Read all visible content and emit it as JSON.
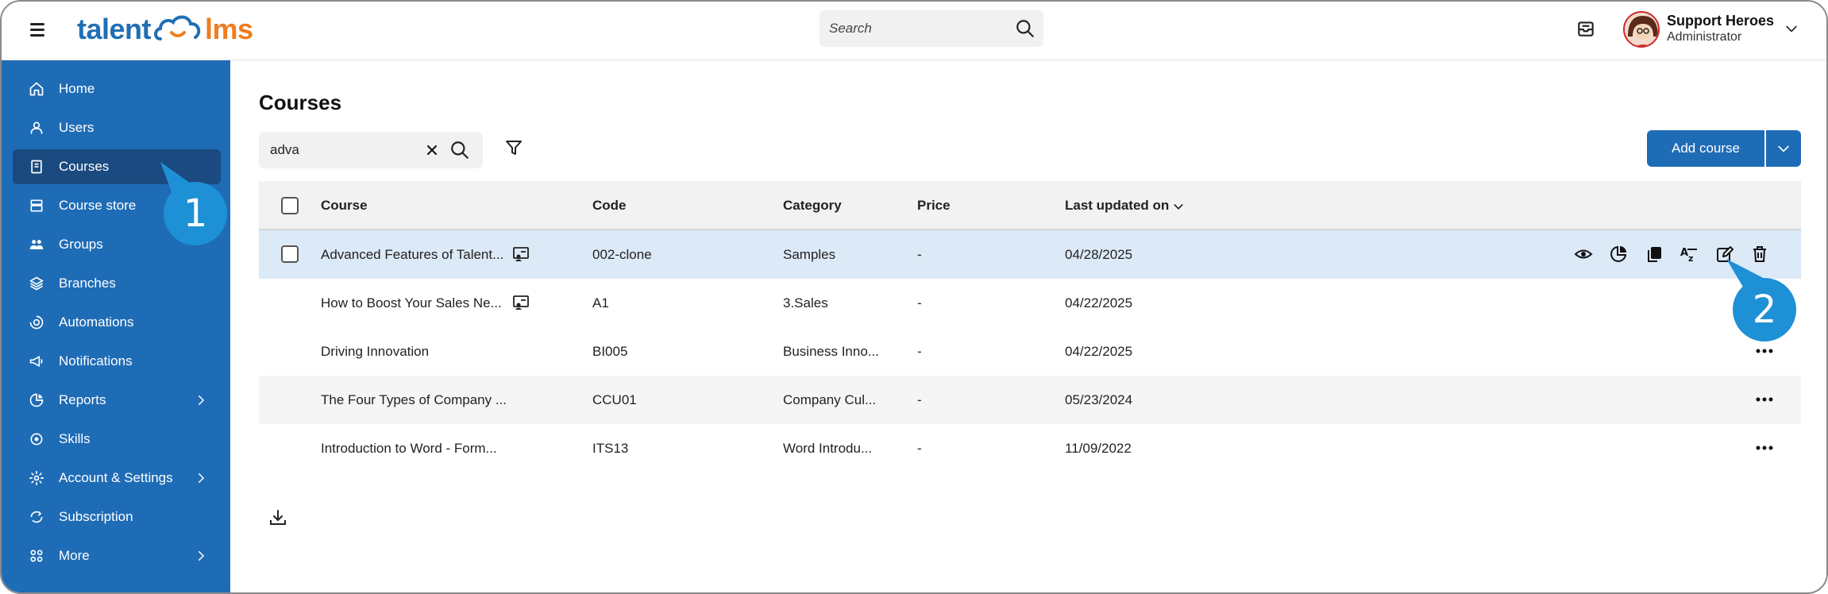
{
  "header": {
    "logo_part1": "talent",
    "logo_part2": "lms",
    "search_placeholder": "Search",
    "user_name": "Support Heroes",
    "user_role": "Administrator"
  },
  "sidebar": {
    "items": [
      {
        "label": "Home",
        "icon": "home-icon"
      },
      {
        "label": "Users",
        "icon": "user-icon"
      },
      {
        "label": "Courses",
        "icon": "book-icon",
        "active": true
      },
      {
        "label": "Course store",
        "icon": "store-icon"
      },
      {
        "label": "Groups",
        "icon": "groups-icon"
      },
      {
        "label": "Branches",
        "icon": "layers-icon"
      },
      {
        "label": "Automations",
        "icon": "automation-icon"
      },
      {
        "label": "Notifications",
        "icon": "megaphone-icon"
      },
      {
        "label": "Reports",
        "icon": "pie-chart-icon",
        "has_submenu": true
      },
      {
        "label": "Skills",
        "icon": "skills-icon"
      },
      {
        "label": "Account & Settings",
        "icon": "gear-icon",
        "has_submenu": true
      },
      {
        "label": "Subscription",
        "icon": "subscription-icon"
      },
      {
        "label": "More",
        "icon": "grid-icon",
        "has_submenu": true
      }
    ]
  },
  "main": {
    "title": "Courses",
    "search_value": "adva",
    "add_course_label": "Add course",
    "columns": [
      "Course",
      "Code",
      "Category",
      "Price",
      "Last updated on"
    ],
    "rows": [
      {
        "course": "Advanced Features of Talent...",
        "code": "002-clone",
        "category": "Samples",
        "price": "-",
        "updated": "04/28/2025",
        "instructor_led": true
      },
      {
        "course": "How to Boost Your Sales Ne...",
        "code": "A1",
        "category": "3.Sales",
        "price": "-",
        "updated": "04/22/2025",
        "instructor_led": true
      },
      {
        "course": "Driving Innovation",
        "code": "BI005",
        "category": "Business Inno...",
        "price": "-",
        "updated": "04/22/2025",
        "instructor_led": false
      },
      {
        "course": "The Four Types of Company ...",
        "code": "CCU01",
        "category": "Company Cul...",
        "price": "-",
        "updated": "05/23/2024",
        "instructor_led": false
      },
      {
        "course": "Introduction to Word - Form...",
        "code": "ITS13",
        "category": "Word Introdu...",
        "price": "-",
        "updated": "11/09/2022",
        "instructor_led": false
      }
    ],
    "row_actions": [
      "eye-icon",
      "pie-chart-icon",
      "copy-icon",
      "translate-icon",
      "edit-icon",
      "trash-icon"
    ]
  },
  "callouts": {
    "step1": "1",
    "step2": "2"
  },
  "colors": {
    "sidebar": "#1f6cb6",
    "active_nav": "#1a4a80",
    "accent": "#1f6cb6",
    "logo_orange": "#f07c1e",
    "callout": "#1e90d6",
    "row_highlight": "#dce9f7"
  }
}
